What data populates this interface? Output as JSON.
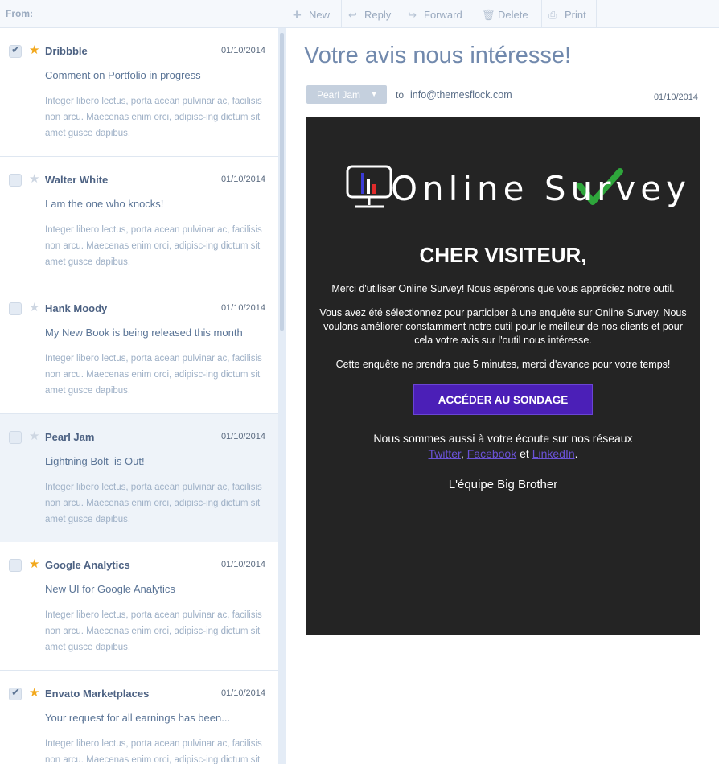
{
  "list_header": {
    "from_label": "From:"
  },
  "toolbar": {
    "new": "New",
    "reply": "Reply",
    "forward": "Forward",
    "delete": "Delete",
    "print": "Print"
  },
  "messages": [
    {
      "sender": "Dribbble",
      "date": "01/10/2014",
      "subject": "Comment on Portfolio in progress",
      "preview": "Integer libero lectus, porta acean pulvinar ac, facilisis non arcu. Maecenas enim orci, adipisc-ing dictum sit amet gusce dapibus.",
      "checked": true,
      "starred": true,
      "selected": false
    },
    {
      "sender": "Walter White",
      "date": "01/10/2014",
      "subject": "I am the one who knocks!",
      "preview": "Integer libero lectus, porta acean pulvinar ac, facilisis non arcu. Maecenas enim orci, adipisc-ing dictum sit amet gusce dapibus.",
      "checked": false,
      "starred": false,
      "selected": false
    },
    {
      "sender": "Hank Moody",
      "date": "01/10/2014",
      "subject": "My New Book is being released this month",
      "preview": "Integer libero lectus, porta acean pulvinar ac, facilisis non arcu. Maecenas enim orci, adipisc-ing dictum sit amet gusce dapibus.",
      "checked": false,
      "starred": false,
      "selected": false
    },
    {
      "sender": "Pearl Jam",
      "date": "01/10/2014",
      "subject": "Lightning Bolt  is Out!",
      "preview": "Integer libero lectus, porta acean pulvinar ac, facilisis non arcu. Maecenas enim orci, adipisc-ing dictum sit amet gusce dapibus.",
      "checked": false,
      "starred": false,
      "selected": true
    },
    {
      "sender": "Google Analytics",
      "date": "01/10/2014",
      "subject": "New UI for Google Analytics",
      "preview": "Integer libero lectus, porta acean pulvinar ac, facilisis non arcu. Maecenas enim orci, adipisc-ing dictum sit amet gusce dapibus.",
      "checked": false,
      "starred": true,
      "selected": false
    },
    {
      "sender": "Envato Marketplaces",
      "date": "01/10/2014",
      "subject": "Your request for all earnings has been...",
      "preview": "Integer libero lectus, porta acean pulvinar ac, facilisis non arcu. Maecenas enim orci, adipisc-ing dictum sit amet gusce dapibus.",
      "checked": true,
      "starred": true,
      "selected": false
    }
  ],
  "reading": {
    "subject": "Votre avis nous intéresse!",
    "from": "Pearl Jam",
    "to_label": "to",
    "to_address": "info@themesflock.com",
    "date": "01/10/2014",
    "email": {
      "logo_text": "Online Survey",
      "greeting": "CHER VISITEUR,",
      "para1": "Merci d'utiliser Online Survey! Nous espérons que vous appréciez notre outil.",
      "para2": "Vous avez été sélectionnez pour participer à une enquête sur Online Survey. Nous voulons améliorer constamment notre outil pour le meilleur de nos clients et pour cela votre avis sur l'outil nous intéresse.",
      "para3": "Cette enquête ne prendra que 5 minutes, merci d'avance pour votre temps!",
      "cta": "ACCÉDER AU SONDAGE",
      "social_intro": "Nous sommes aussi à votre écoute sur nos réseaux",
      "link_twitter": "Twitter",
      "link_facebook": "Facebook",
      "connector": "et",
      "link_linkedin": "LinkedIn",
      "signature": "L'équipe Big Brother"
    }
  },
  "colors": {
    "accent_star": "#f2a81c",
    "email_background": "#242424",
    "cta_background": "#4b1fb7",
    "checkmark_green": "#2ea63b"
  }
}
